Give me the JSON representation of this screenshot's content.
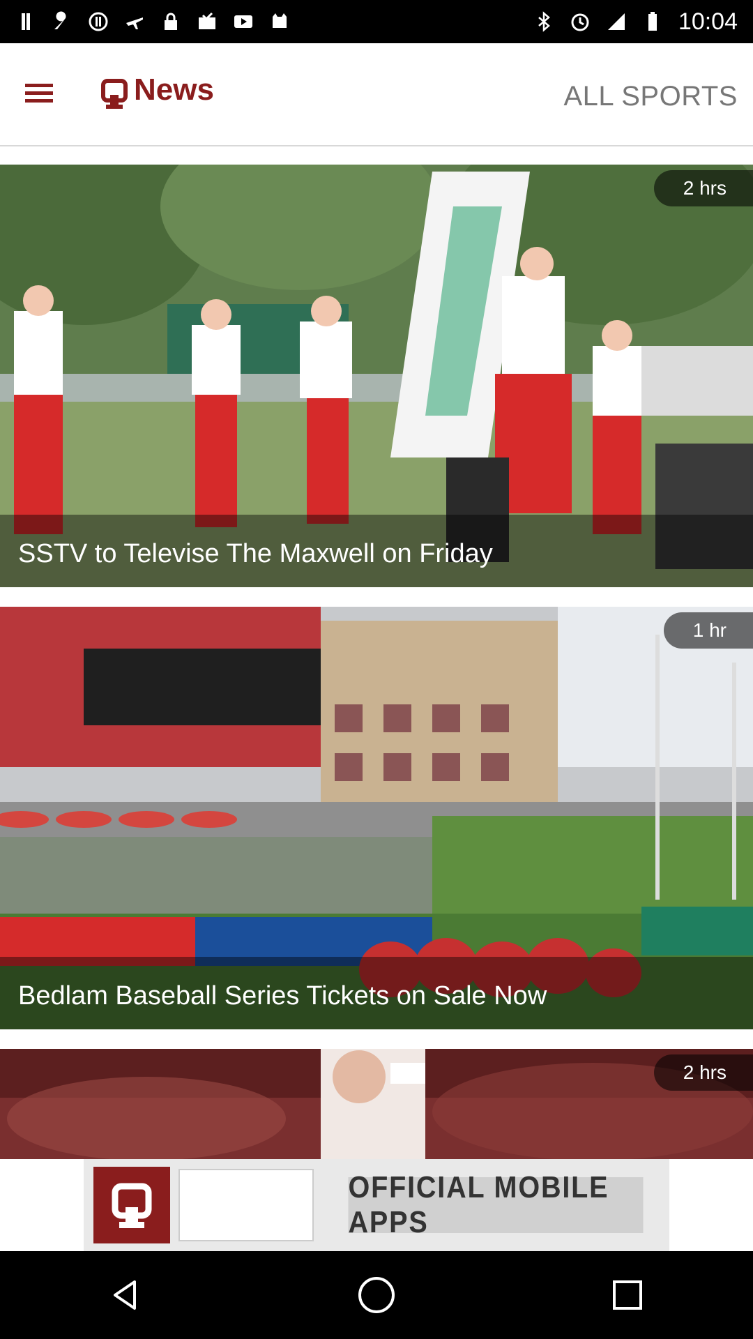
{
  "status_bar": {
    "time": "10:04",
    "left_icons": [
      "menu-lines-icon",
      "wrench-icon",
      "alert-icon",
      "airplane-icon",
      "lock-icon",
      "mail-check-icon",
      "play-icon",
      "cat-icon"
    ],
    "right_icons": [
      "bluetooth-icon",
      "alarm-icon",
      "signal-icon",
      "battery-icon"
    ]
  },
  "header": {
    "title": "News",
    "right_label": "ALL SPORTS",
    "accent": "#8a1d1d"
  },
  "cards": [
    {
      "time_ago": "2 hrs",
      "caption": "SSTV to Televise The Maxwell on Friday"
    },
    {
      "time_ago": "1 hr",
      "caption": "Bedlam Baseball Series Tickets on Sale Now"
    },
    {
      "time_ago": "2 hrs",
      "caption": ""
    }
  ],
  "ad": {
    "text": "OFFICIAL MOBILE APPS"
  },
  "navbar": {
    "buttons": [
      "back-icon",
      "home-icon",
      "recents-icon"
    ]
  }
}
